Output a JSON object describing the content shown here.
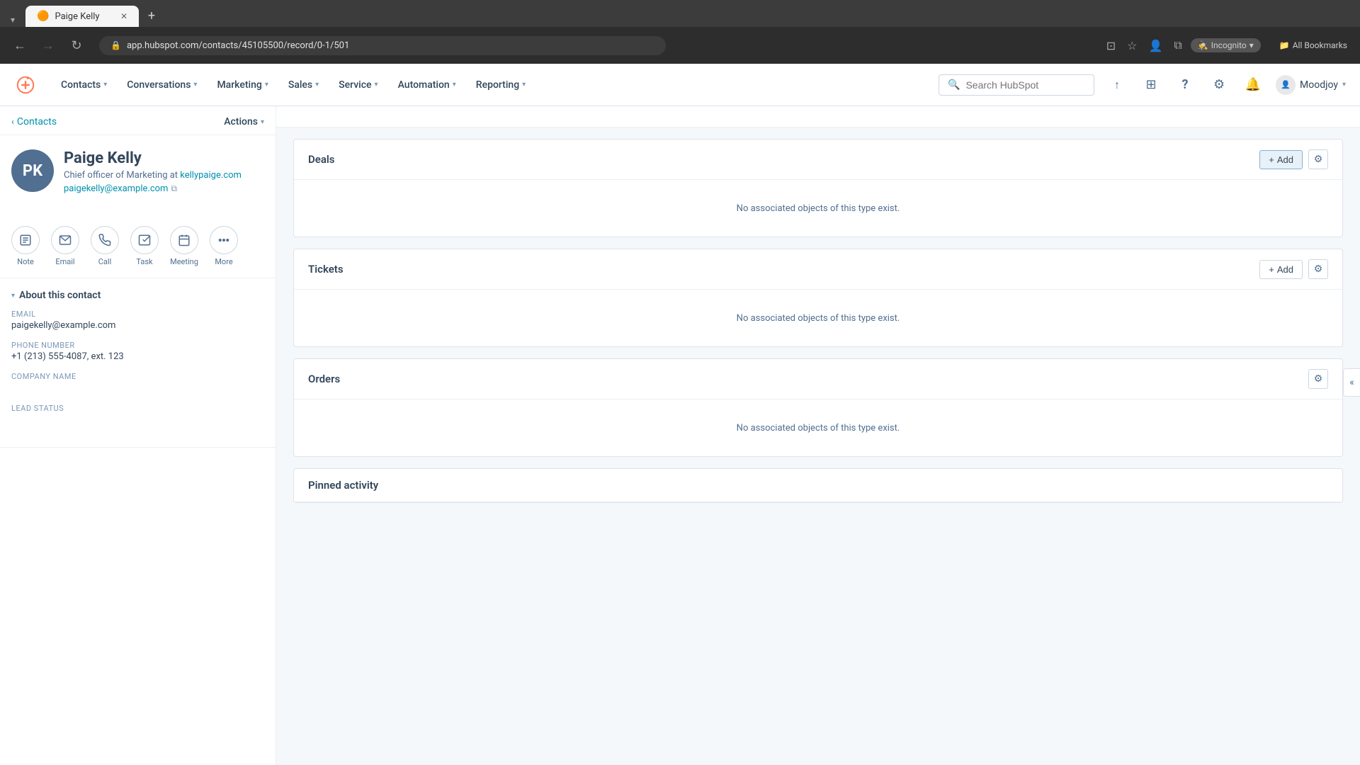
{
  "browser": {
    "tab_label": "Paige Kelly",
    "tab_icon": "●",
    "url": "app.hubspot.com/contacts/45105500/record/0-1/501",
    "url_full": "app.hubspot.com/contacts/45105500/record/0-1/501",
    "new_tab_label": "+",
    "back_label": "←",
    "forward_label": "→",
    "refresh_label": "↻",
    "incognito_label": "Incognito",
    "bookmarks_label": "All Bookmarks"
  },
  "navbar": {
    "logo_label": "HubSpot",
    "items": [
      {
        "label": "Contacts",
        "has_dropdown": true
      },
      {
        "label": "Conversations",
        "has_dropdown": true
      },
      {
        "label": "Marketing",
        "has_dropdown": true
      },
      {
        "label": "Sales",
        "has_dropdown": true
      },
      {
        "label": "Service",
        "has_dropdown": true
      },
      {
        "label": "Automation",
        "has_dropdown": true
      },
      {
        "label": "Reporting",
        "has_dropdown": true
      }
    ],
    "search_placeholder": "Search HubSpot",
    "user_name": "Moodjoy",
    "user_chevron": "▾"
  },
  "sidebar": {
    "breadcrumb_back": "‹",
    "breadcrumb_label": "Contacts",
    "actions_label": "Actions",
    "actions_chevron": "▾",
    "contact": {
      "initials": "PK",
      "name": "Paige Kelly",
      "title": "Chief officer of Marketing at",
      "company_link": "kellypaige.com",
      "email": "paigekelly@example.com",
      "email_copy_icon": "⧉"
    },
    "action_buttons": [
      {
        "icon": "📝",
        "label": "Note",
        "name": "note-button"
      },
      {
        "icon": "✉",
        "label": "Email",
        "name": "email-button"
      },
      {
        "icon": "📞",
        "label": "Call",
        "name": "call-button"
      },
      {
        "icon": "✓",
        "label": "Task",
        "name": "task-button"
      },
      {
        "icon": "📅",
        "label": "Meeting",
        "name": "meeting-button"
      },
      {
        "icon": "•••",
        "label": "More",
        "name": "more-button"
      }
    ],
    "section": {
      "title": "About this contact",
      "chevron": "▾",
      "fields": [
        {
          "label": "Email",
          "value": "paigekelly@example.com",
          "empty": false
        },
        {
          "label": "Phone number",
          "value": "+1 (213) 555-4087, ext. 123",
          "empty": false
        },
        {
          "label": "Company name",
          "value": "",
          "empty": true
        },
        {
          "label": "Lead status",
          "value": "",
          "empty": true
        }
      ]
    }
  },
  "main": {
    "cards": [
      {
        "id": "deals",
        "title": "Deals",
        "add_label": "+ Add",
        "empty_message": "No associated objects of this type exist.",
        "has_gear": true,
        "has_add": true
      },
      {
        "id": "tickets",
        "title": "Tickets",
        "add_label": "+ Add",
        "empty_message": "No associated objects of this type exist.",
        "has_gear": true,
        "has_add": true
      },
      {
        "id": "orders",
        "title": "Orders",
        "add_label": "",
        "empty_message": "No associated objects of this type exist.",
        "has_gear": true,
        "has_add": false
      },
      {
        "id": "pinned-activity",
        "title": "Pinned activity",
        "add_label": "",
        "empty_message": "",
        "has_gear": false,
        "has_add": false
      }
    ]
  },
  "icons": {
    "hubspot_orange": "#ff7a59",
    "link_blue": "#0091ae",
    "muted": "#7c98b6",
    "gear": "⚙",
    "chevron_left": "«",
    "collapse": "»",
    "search": "🔍",
    "help": "?",
    "settings": "⚙",
    "bell": "🔔",
    "market": "⊞",
    "upgrade": "↑",
    "incognito_hat": "🕵"
  }
}
